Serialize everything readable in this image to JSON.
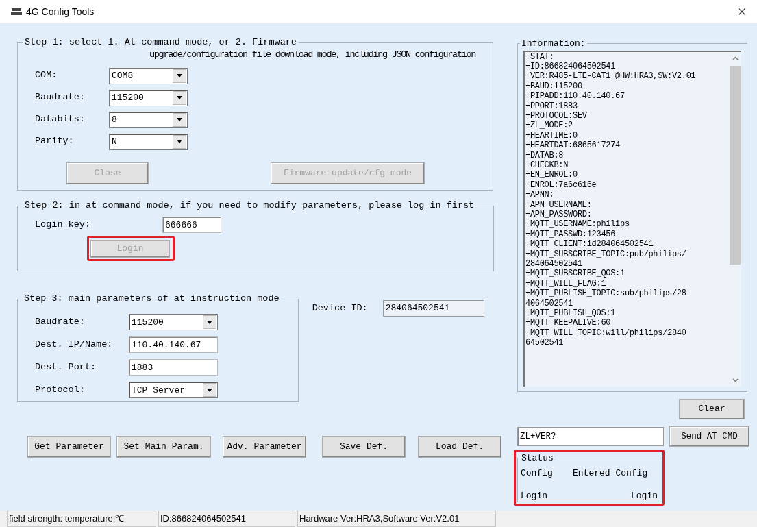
{
  "window": {
    "title": "4G Config Tools"
  },
  "step1": {
    "title_lines": [
      "Step 1: select 1. At command mode, or 2. Firmware",
      "upgrade/configuration file download mode, including JSON configuration"
    ],
    "fields": [
      {
        "label": "COM:",
        "value": "COM8",
        "kind": "select"
      },
      {
        "label": "Baudrate:",
        "value": "115200",
        "kind": "select"
      },
      {
        "label": "Databits:",
        "value": "8",
        "kind": "select"
      },
      {
        "label": "Parity:",
        "value": "N",
        "kind": "select"
      }
    ],
    "buttons": [
      {
        "label": "Close",
        "disabled": true
      },
      {
        "label": "Firmware update/cfg mode",
        "disabled": true
      }
    ]
  },
  "step2": {
    "title": "Step 2: in at command mode, if you need to modify parameters, please log in first",
    "fields": [
      {
        "label": "Login key:",
        "value": "666666",
        "kind": "text"
      }
    ],
    "button": {
      "label": "Login",
      "disabled": true,
      "highlighted": true
    }
  },
  "step3": {
    "title": "Step 3: main parameters of at instruction mode",
    "fields": [
      {
        "label": "Baudrate:",
        "value": "115200",
        "kind": "select"
      },
      {
        "label": "Dest. IP/Name:",
        "value": "110.40.140.67",
        "kind": "text"
      },
      {
        "label": "Dest. Port:",
        "value": "1883",
        "kind": "text"
      },
      {
        "label": "Protocol:",
        "value": "TCP Server",
        "kind": "select"
      }
    ]
  },
  "device_id": {
    "label": "Device ID:",
    "value": "284064502541"
  },
  "actions": [
    {
      "label": "Get Parameter",
      "disabled": false
    },
    {
      "label": "Set Main Param.",
      "disabled": false
    },
    {
      "label": "Adv. Parameter",
      "disabled": false
    },
    {
      "label": "Save Def.",
      "disabled": false
    },
    {
      "label": "Load Def.",
      "disabled": false
    }
  ],
  "information": {
    "title": "Information:",
    "lines": [
      "+STAT:",
      "+ID:866824064502541",
      "+VER:R485-LTE-CAT1 @HW:HRA3,SW:V2.01",
      "+BAUD:115200",
      "+PIPADD:110.40.140.67",
      "+PPORT:1883",
      "+PROTOCOL:SEV",
      "+ZL_MODE:2",
      "+HEARTIME:0",
      "+HEARTDAT:6865617274",
      "+DATAB:8",
      "+CHECKB:N",
      "+EN_ENROL:0",
      "+ENROL:7a6c616e",
      "+APNN:",
      "+APN_USERNAME:",
      "+APN_PASSWORD:",
      "+MQTT_USERNAME:philips",
      "+MQTT_PASSWD:123456",
      "+MQTT_CLIENT:id284064502541",
      "+MQTT_SUBSCRIBE_TOPIC:pub/philips/",
      "284064502541",
      "+MQTT_SUBSCRIBE_QOS:1",
      "+MQTT_WILL_FLAG:1",
      "+MQTT_PUBLISH_TOPIC:sub/philips/28",
      "4064502541",
      "+MQTT_PUBLISH_QOS:1",
      "+MQTT_KEEPALIVE:60",
      "+MQTT_WILL_TOPIC:will/philips/2840",
      "64502541"
    ]
  },
  "clear_button": {
    "label": "Clear",
    "disabled": false
  },
  "command": {
    "value": "ZL+VER?",
    "button": "Send AT CMD"
  },
  "status": {
    "title": "Status",
    "highlighted": true,
    "rows": [
      [
        "Config",
        "Entered Config"
      ],
      [
        "Login",
        "Login"
      ]
    ]
  },
  "status_bar": [
    "field strength: temperature:℃",
    "ID:866824064502541",
    "Hardware Ver:HRA3,Software Ver:V2.01"
  ]
}
